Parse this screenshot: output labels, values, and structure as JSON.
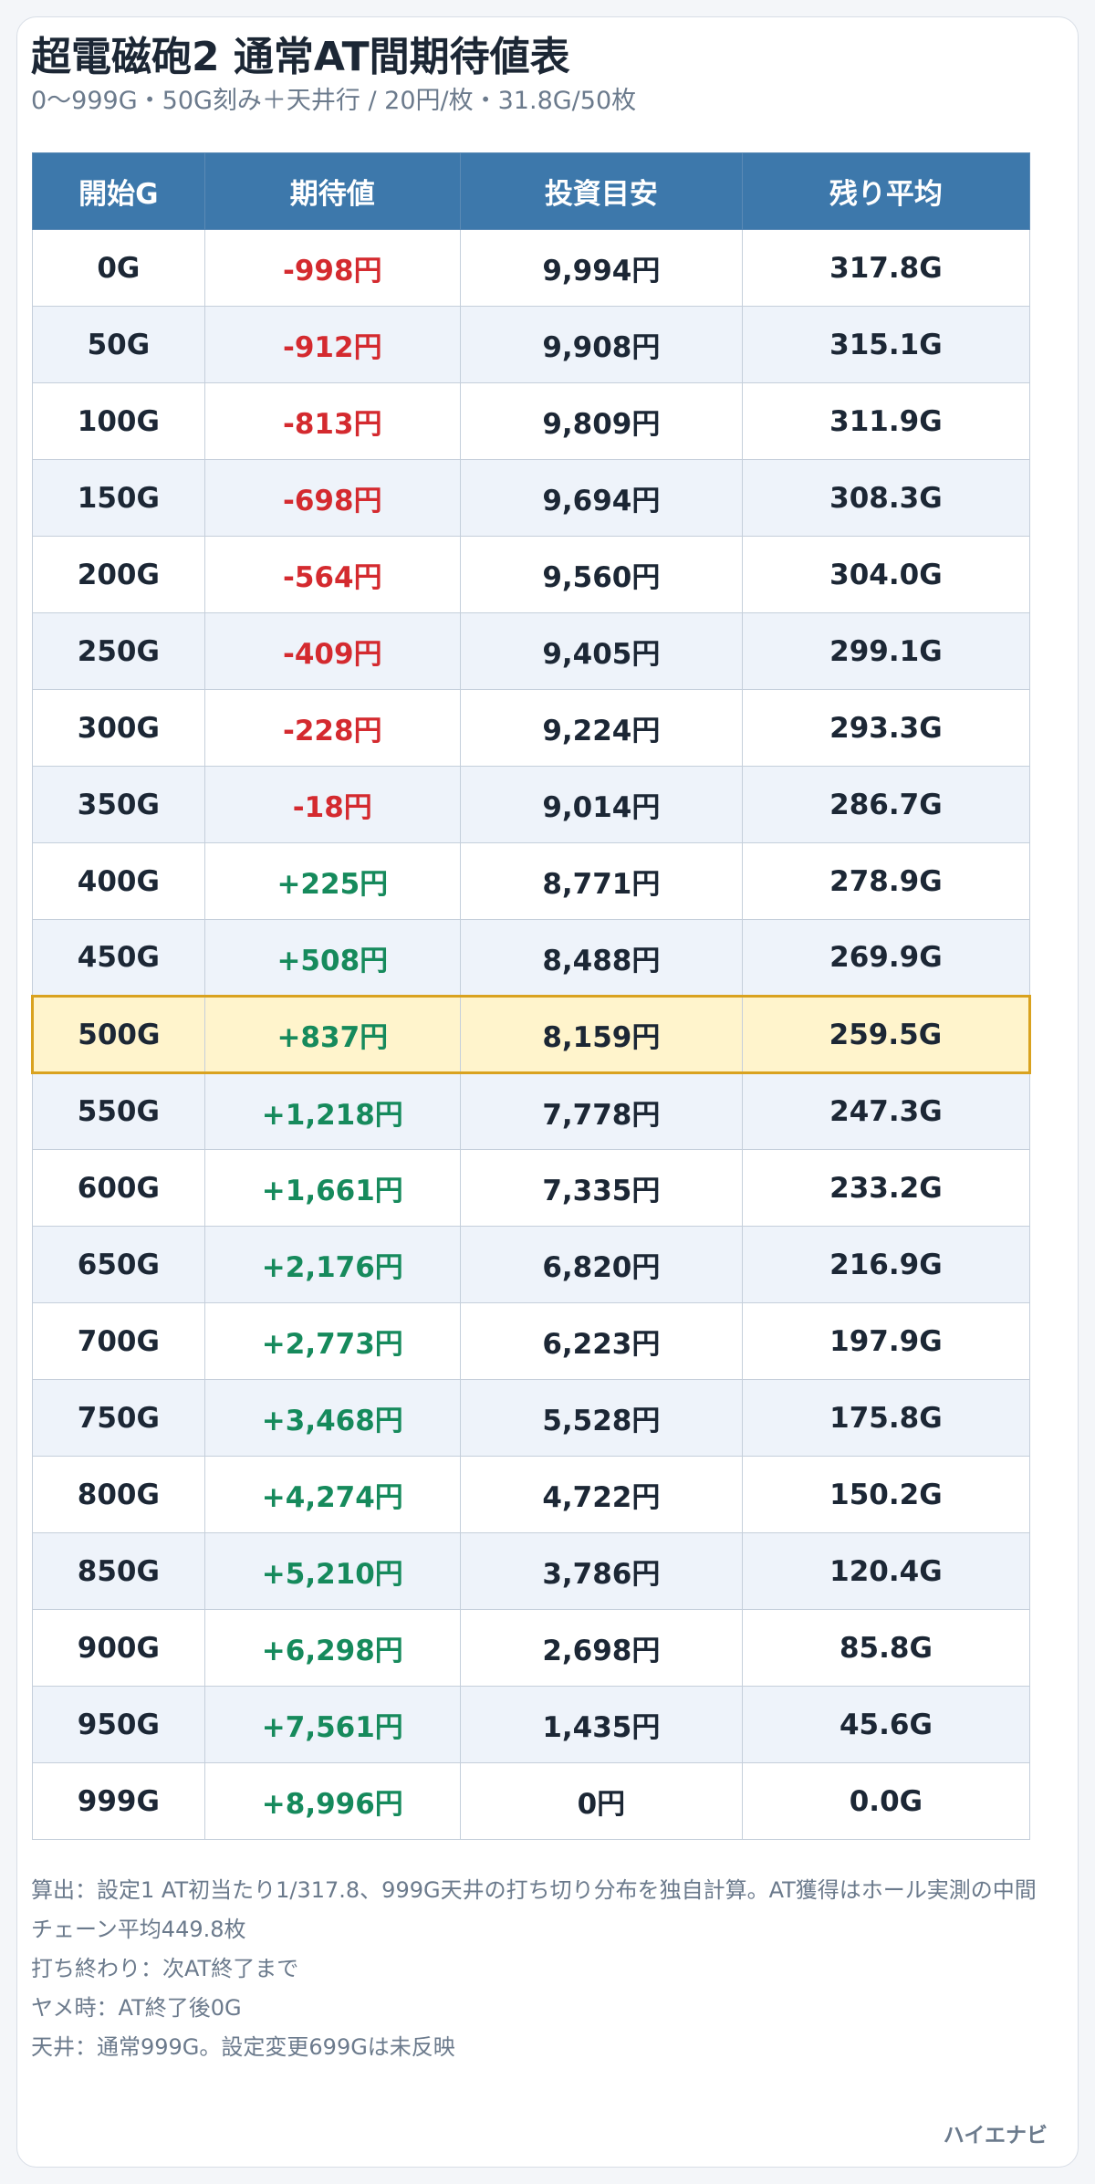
{
  "header": {
    "title": "超電磁砲2 通常AT間期待値表",
    "subtitle": "0〜999G・50G刻み＋天井行 / 20円/枚・31.8G/50枚"
  },
  "table": {
    "columns": [
      "開始G",
      "期待値",
      "投資目安",
      "残り平均"
    ],
    "highlight_row": 10,
    "rows": [
      {
        "start": "0G",
        "ev": "-998円",
        "sign": "neg",
        "invest": "9,994円",
        "remain": "317.8G"
      },
      {
        "start": "50G",
        "ev": "-912円",
        "sign": "neg",
        "invest": "9,908円",
        "remain": "315.1G"
      },
      {
        "start": "100G",
        "ev": "-813円",
        "sign": "neg",
        "invest": "9,809円",
        "remain": "311.9G"
      },
      {
        "start": "150G",
        "ev": "-698円",
        "sign": "neg",
        "invest": "9,694円",
        "remain": "308.3G"
      },
      {
        "start": "200G",
        "ev": "-564円",
        "sign": "neg",
        "invest": "9,560円",
        "remain": "304.0G"
      },
      {
        "start": "250G",
        "ev": "-409円",
        "sign": "neg",
        "invest": "9,405円",
        "remain": "299.1G"
      },
      {
        "start": "300G",
        "ev": "-228円",
        "sign": "neg",
        "invest": "9,224円",
        "remain": "293.3G"
      },
      {
        "start": "350G",
        "ev": "-18円",
        "sign": "neg",
        "invest": "9,014円",
        "remain": "286.7G"
      },
      {
        "start": "400G",
        "ev": "+225円",
        "sign": "pos",
        "invest": "8,771円",
        "remain": "278.9G"
      },
      {
        "start": "450G",
        "ev": "+508円",
        "sign": "pos",
        "invest": "8,488円",
        "remain": "269.9G"
      },
      {
        "start": "500G",
        "ev": "+837円",
        "sign": "pos",
        "invest": "8,159円",
        "remain": "259.5G"
      },
      {
        "start": "550G",
        "ev": "+1,218円",
        "sign": "pos",
        "invest": "7,778円",
        "remain": "247.3G"
      },
      {
        "start": "600G",
        "ev": "+1,661円",
        "sign": "pos",
        "invest": "7,335円",
        "remain": "233.2G"
      },
      {
        "start": "650G",
        "ev": "+2,176円",
        "sign": "pos",
        "invest": "6,820円",
        "remain": "216.9G"
      },
      {
        "start": "700G",
        "ev": "+2,773円",
        "sign": "pos",
        "invest": "6,223円",
        "remain": "197.9G"
      },
      {
        "start": "750G",
        "ev": "+3,468円",
        "sign": "pos",
        "invest": "5,528円",
        "remain": "175.8G"
      },
      {
        "start": "800G",
        "ev": "+4,274円",
        "sign": "pos",
        "invest": "4,722円",
        "remain": "150.2G"
      },
      {
        "start": "850G",
        "ev": "+5,210円",
        "sign": "pos",
        "invest": "3,786円",
        "remain": "120.4G"
      },
      {
        "start": "900G",
        "ev": "+6,298円",
        "sign": "pos",
        "invest": "2,698円",
        "remain": "85.8G"
      },
      {
        "start": "950G",
        "ev": "+7,561円",
        "sign": "pos",
        "invest": "1,435円",
        "remain": "45.6G"
      },
      {
        "start": "999G",
        "ev": "+8,996円",
        "sign": "pos",
        "invest": "0円",
        "remain": "0.0G"
      }
    ]
  },
  "notes": [
    "算出：設定1 AT初当たり1/317.8、999G天井の打ち切り分布を独自計算。AT獲得はホール実測の中間チェーン平均449.8枚",
    "打ち終わり：次AT終了まで",
    "ヤメ時：AT終了後0G",
    "天井：通常999G。設定変更699Gは未反映"
  ],
  "brand": "ハイエナビ",
  "colors": {
    "header_bg": "#3d78ab",
    "negative": "#d42a2f",
    "positive": "#168a5c",
    "highlight_bg": "#fff4cc",
    "highlight_border": "#d9a21f"
  }
}
